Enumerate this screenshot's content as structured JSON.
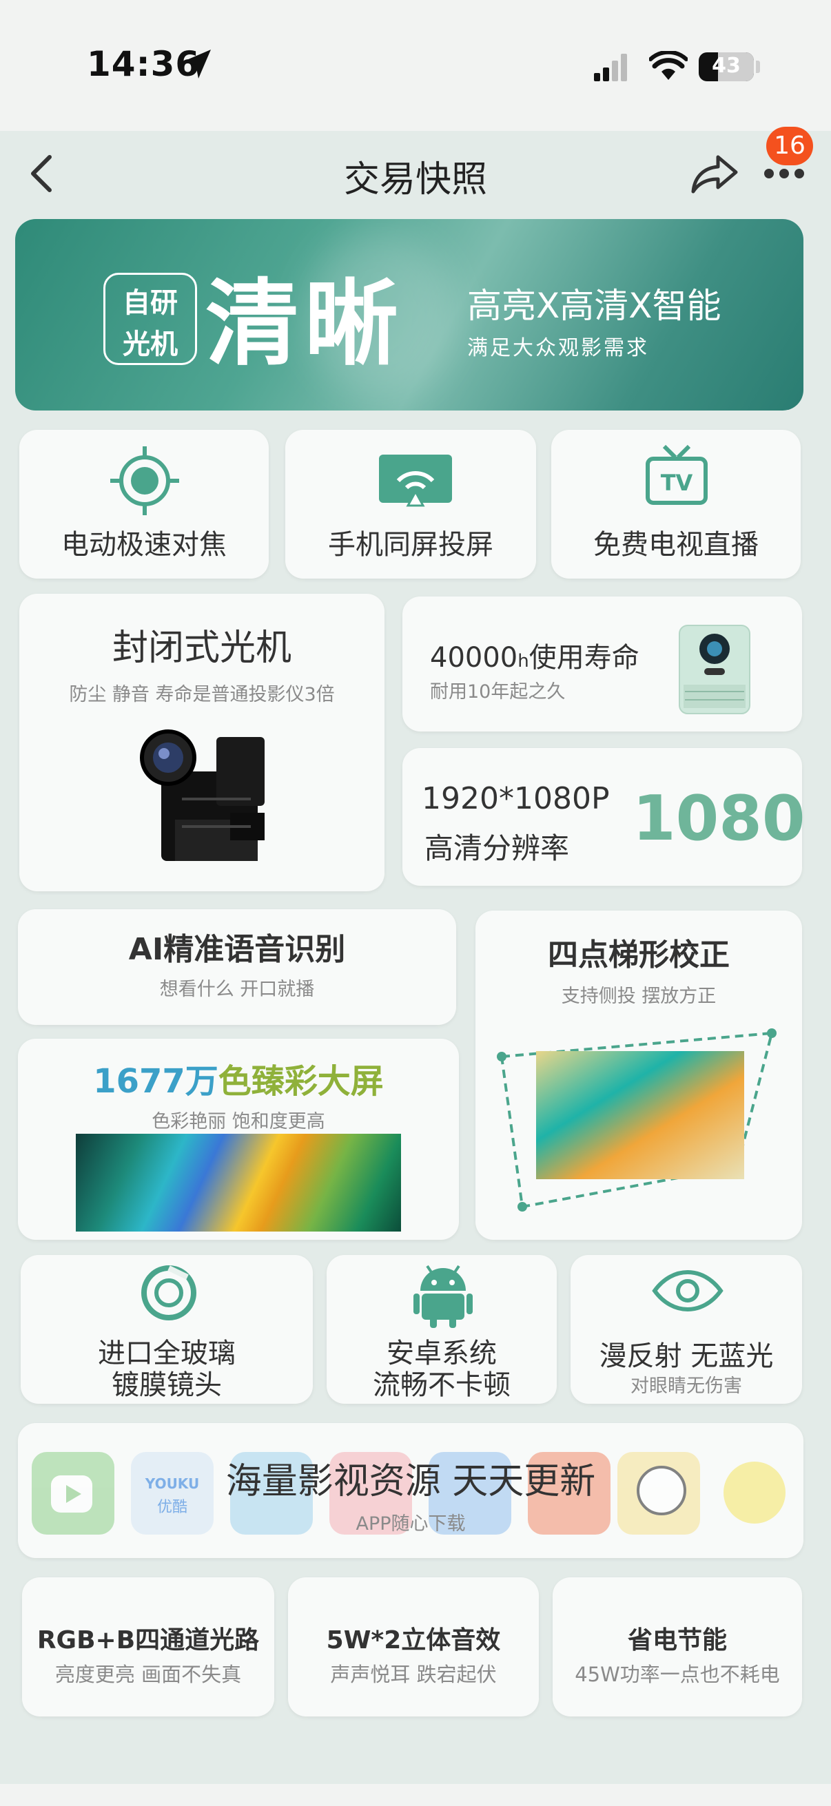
{
  "status": {
    "time": "14:36",
    "battery": "43"
  },
  "nav": {
    "title": "交易快照",
    "badge": "16"
  },
  "hero": {
    "tag_line1": "自研",
    "tag_line2": "光机",
    "headline": "清晰",
    "tagline": "高亮X高清X智能",
    "subtag": "满足大众观影需求"
  },
  "features_row1": [
    {
      "label": "电动极速对焦"
    },
    {
      "label": "手机同屏投屏"
    },
    {
      "label": "免费电视直播"
    }
  ],
  "sealed": {
    "title": "封闭式光机",
    "subtitle": "防尘 静音 寿命是普通投影仪3倍"
  },
  "lifespan": {
    "title_num": "40000",
    "title_unit": "h",
    "title_rest": "使用寿命",
    "subtitle": "耐用10年起之久"
  },
  "resolution": {
    "line1": "1920*1080P",
    "line2": "高清分辨率",
    "big": "1080"
  },
  "voice": {
    "title": "AI精准语音识别",
    "subtitle": "想看什么 开口就播"
  },
  "keystone": {
    "title": "四点梯形校正",
    "subtitle": "支持侧投 摆放方正"
  },
  "color": {
    "title_part1": "1677万",
    "title_part2": "色臻彩大屏",
    "subtitle": "色彩艳丽 饱和度更高"
  },
  "features_row4": [
    {
      "line1": "进口全玻璃",
      "line2": "镀膜镜头"
    },
    {
      "line1": "安卓系统",
      "line2": "流畅不卡顿"
    },
    {
      "line1": "漫反射 无蓝光",
      "line2": "对眼睛无伤害"
    }
  ],
  "resources": {
    "title": "海量影视资源 天天更新",
    "subtitle": "APP随心下载",
    "apps": [
      "youku",
      "优酷",
      "YOUKU"
    ]
  },
  "features_row6": [
    {
      "title": "RGB+B四通道光路",
      "subtitle": "亮度更亮 画面不失真"
    },
    {
      "title": "5W*2立体音效",
      "subtitle": "声声悦耳 跌宕起伏"
    },
    {
      "title": "省电节能",
      "subtitle": "45W功率一点也不耗电"
    }
  ],
  "colors": {
    "accent": "#4aa58c",
    "badge": "#f4511e",
    "big_number": "#6fb59a"
  }
}
